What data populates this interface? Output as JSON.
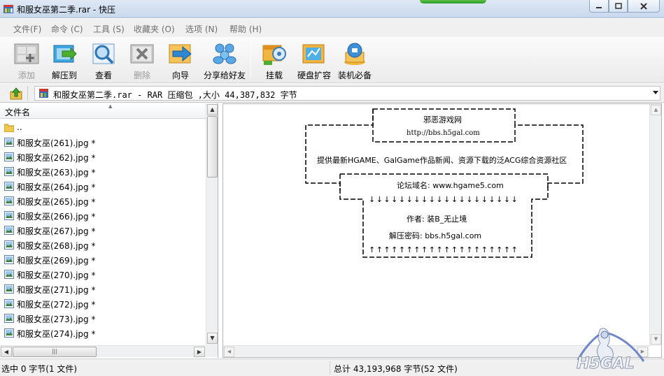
{
  "window": {
    "title": "和服女巫第二季.rar - 快压"
  },
  "menu": {
    "items": [
      "文件(F)",
      "命令 (C)",
      "工具 (S)",
      "收藏夹 (O)",
      "选项 (N)",
      "帮助 (H)"
    ]
  },
  "toolbar": {
    "buttons": [
      {
        "label": "添加",
        "icon": "add-archive-icon",
        "enabled": false
      },
      {
        "label": "解压到",
        "icon": "extract-to-icon",
        "enabled": true
      },
      {
        "label": "查看",
        "icon": "view-magnifier-icon",
        "enabled": true
      },
      {
        "label": "删除",
        "icon": "delete-icon",
        "enabled": false
      },
      {
        "label": "向导",
        "icon": "wizard-arrow-icon",
        "enabled": true
      },
      {
        "label": "分享给好友",
        "icon": "share-friends-icon",
        "enabled": true
      },
      {
        "label": "挂载",
        "icon": "mount-icon",
        "enabled": true
      },
      {
        "label": "硬盘扩容",
        "icon": "disk-expand-icon",
        "enabled": true
      },
      {
        "label": "装机必备",
        "icon": "install-essentials-icon",
        "enabled": true
      }
    ]
  },
  "address": {
    "text": "和服女巫第二季.rar - RAR 压缩包 ,大小 44,387,832 字节"
  },
  "filelist": {
    "column_header": "文件名",
    "parent_label": "..",
    "files": [
      "和服女巫(261).jpg *",
      "和服女巫(262).jpg *",
      "和服女巫(263).jpg *",
      "和服女巫(264).jpg *",
      "和服女巫(265).jpg *",
      "和服女巫(266).jpg *",
      "和服女巫(267).jpg *",
      "和服女巫(268).jpg *",
      "和服女巫(269).jpg *",
      "和服女巫(270).jpg *",
      "和服女巫(271).jpg *",
      "和服女巫(272).jpg *",
      "和服女巫(273).jpg *",
      "和服女巫(274).jpg *"
    ]
  },
  "comment": {
    "site_name": "邪恶游戏网",
    "site_url": "http://bbs.h5gal.com",
    "description": "提供最新HGAME、GalGame作品新闻、资源下载的泛ACG综合资源社区",
    "forum_domain": "论坛域名: www.hgame5.com",
    "down_arrows": "↓↓↓↓↓↓↓↓↓↓↓↓↓↓↓↓↓↓↓↓",
    "author": "作者: 装B_无止境",
    "password": "解压密码: bbs.h5gal.com",
    "up_arrows": "↑↑↑↑↑↑↑↑↑↑↑↑↑↑↑↑↑↑↑↑"
  },
  "status": {
    "left": "选中  0 字节(1 文件)",
    "right": "总计  43,193,968 字节(52 文件)"
  },
  "watermark": {
    "text": "H5GAL"
  },
  "colors": {
    "titlebar": "#c8d8ec",
    "menu_text": "#6e6e6e",
    "disabled_label": "#9a9a9a"
  }
}
